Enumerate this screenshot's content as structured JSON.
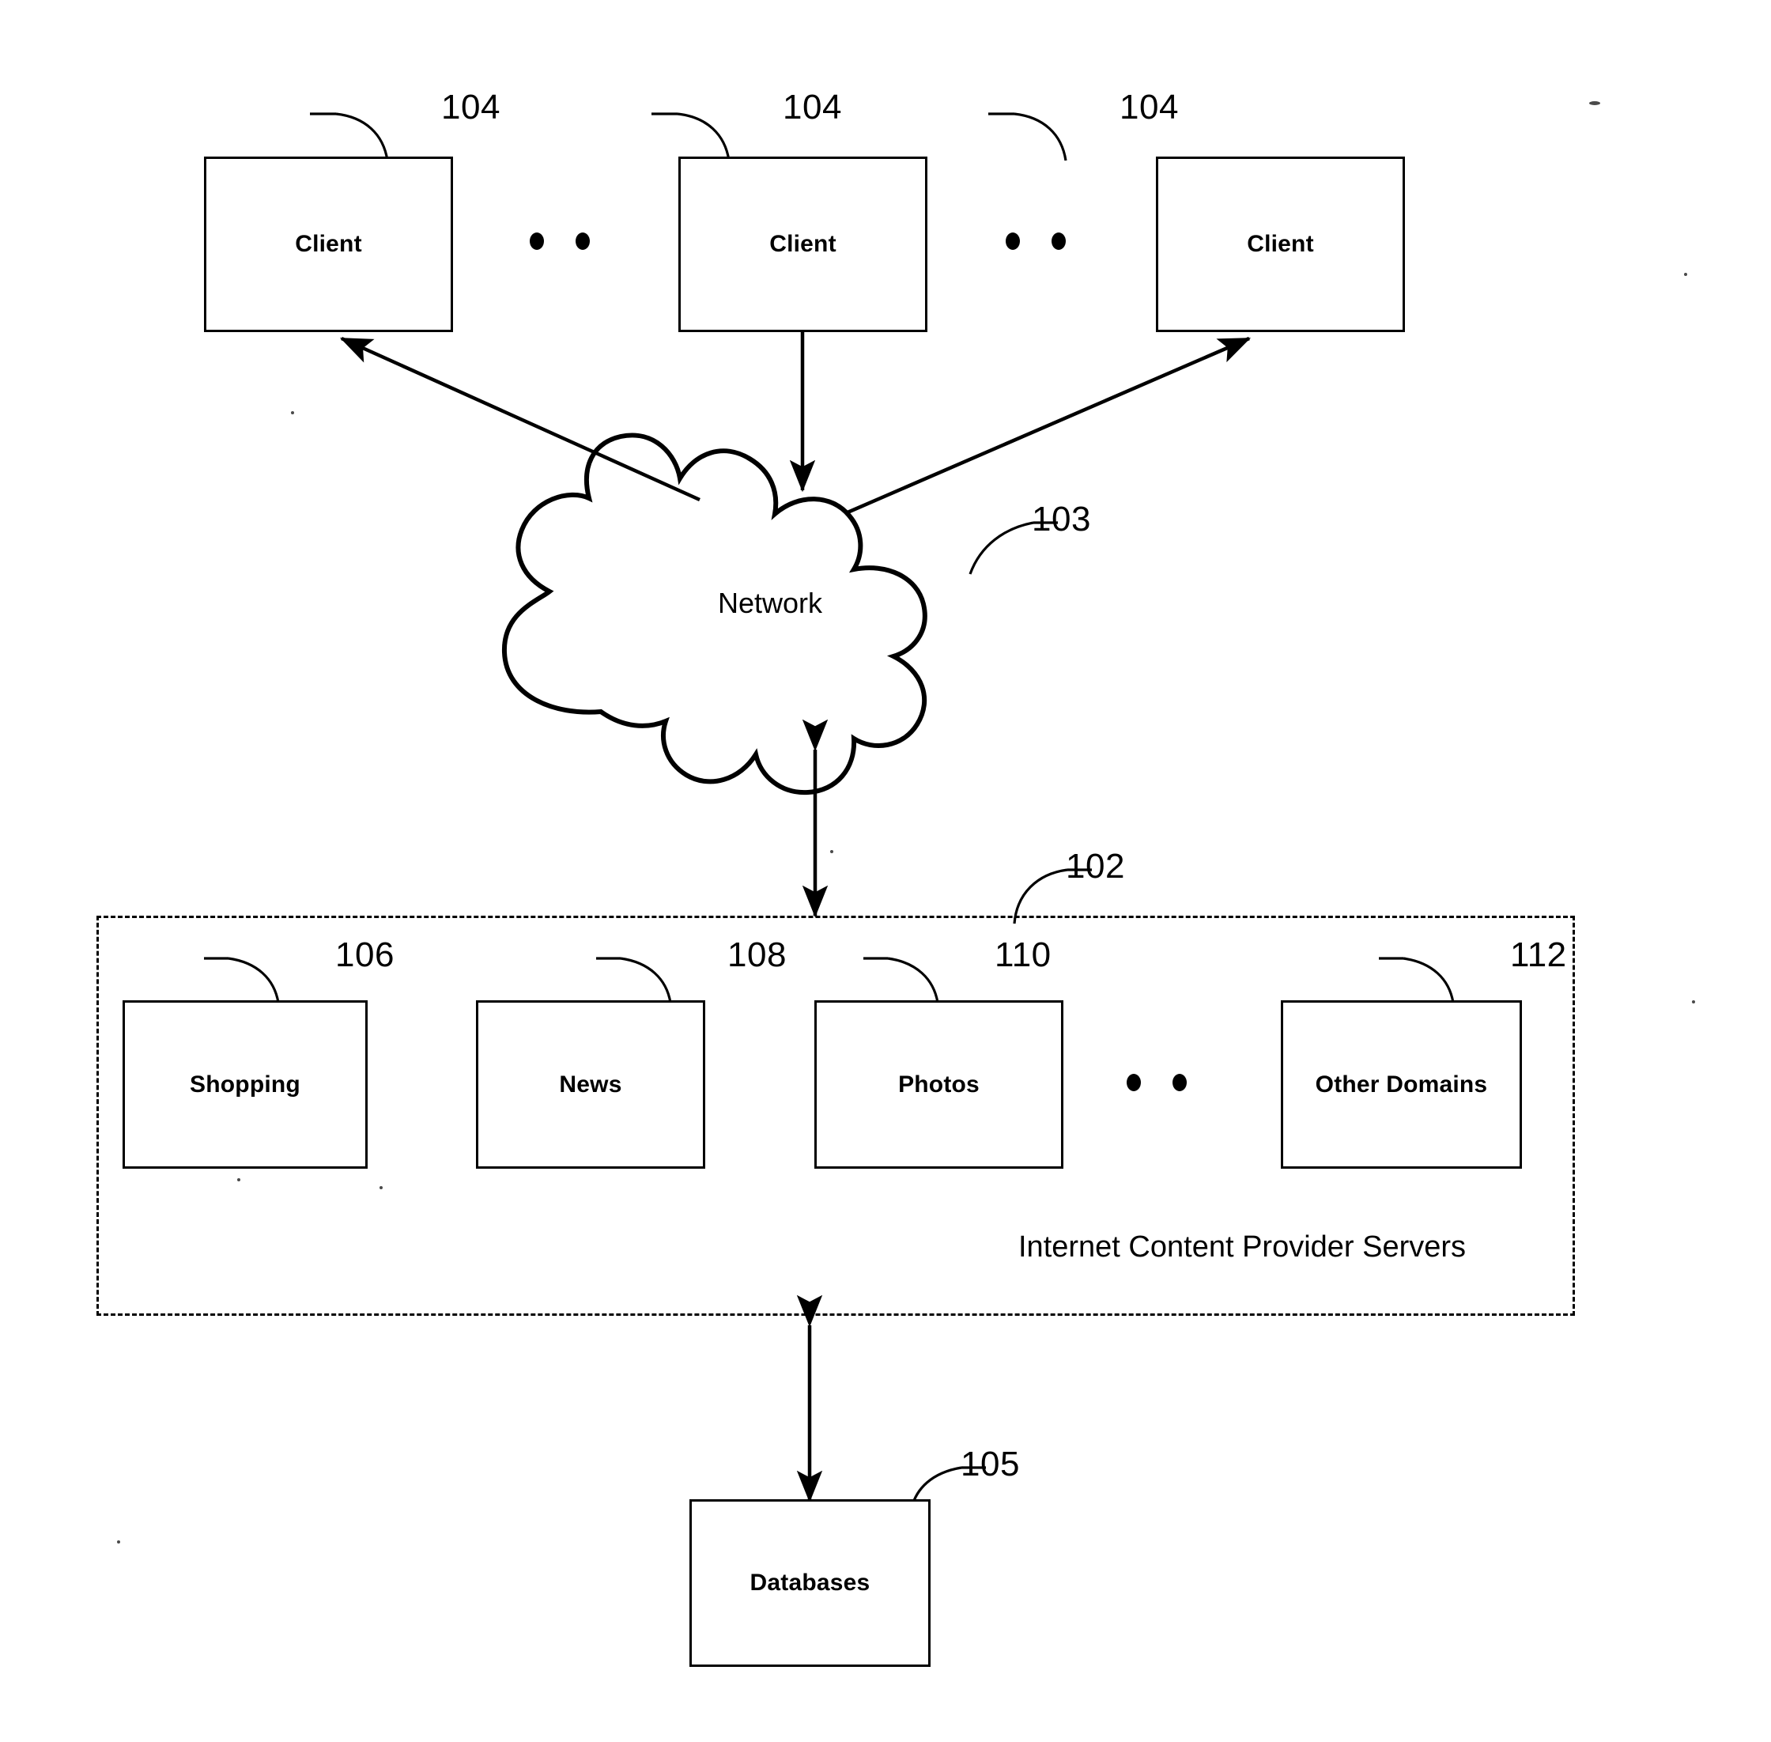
{
  "figure": {
    "title": "Network system block diagram",
    "background_color": "#ffffff",
    "line_color": "#000000"
  },
  "clients": [
    {
      "label": "Client",
      "ref": "104"
    },
    {
      "label": "Client",
      "ref": "104"
    },
    {
      "label": "Client",
      "ref": "104"
    }
  ],
  "network": {
    "label": "Network",
    "ref": "103"
  },
  "provider_region": {
    "ref": "102",
    "caption": "Internet Content Provider Servers"
  },
  "servers": [
    {
      "label": "Shopping",
      "ref": "106"
    },
    {
      "label": "News",
      "ref": "108"
    },
    {
      "label": "Photos",
      "ref": "110"
    },
    {
      "label": "Other Domains",
      "ref": "112"
    }
  ],
  "databases": {
    "label": "Databases",
    "ref": "105"
  },
  "ellipses": {
    "clients_row_1": "• •",
    "clients_row_2": "• •",
    "servers_row": "• •"
  }
}
